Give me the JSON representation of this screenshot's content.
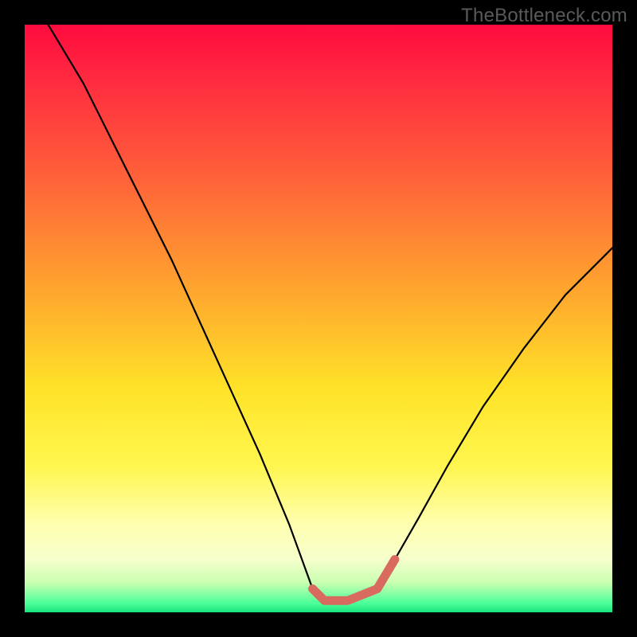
{
  "watermark": "TheBottleneck.com",
  "chart_data": {
    "type": "line",
    "title": "",
    "xlabel": "",
    "ylabel": "",
    "xlim": [
      0,
      100
    ],
    "ylim": [
      0,
      100
    ],
    "grid": false,
    "series": [
      {
        "name": "bottleneck-curve",
        "x": [
          4,
          10,
          15,
          20,
          25,
          30,
          35,
          40,
          45,
          49,
          51,
          55,
          60,
          63,
          67,
          72,
          78,
          85,
          92,
          100
        ],
        "values": [
          100,
          90,
          80,
          70,
          60,
          49,
          38,
          27,
          15,
          4,
          2,
          2,
          4,
          9,
          16,
          25,
          35,
          45,
          54,
          62
        ]
      }
    ],
    "highlight_segment": {
      "x": [
        49,
        51,
        55,
        60,
        63
      ],
      "values": [
        4,
        2,
        2,
        4,
        9
      ]
    },
    "gradient_stops": [
      {
        "pos": 0.0,
        "color": "#ff0b3e"
      },
      {
        "pos": 0.08,
        "color": "#ff2640"
      },
      {
        "pos": 0.25,
        "color": "#ff5e3a"
      },
      {
        "pos": 0.45,
        "color": "#ffa52e"
      },
      {
        "pos": 0.62,
        "color": "#ffe328"
      },
      {
        "pos": 0.75,
        "color": "#fff64e"
      },
      {
        "pos": 0.85,
        "color": "#ffffb0"
      },
      {
        "pos": 0.91,
        "color": "#f6ffcc"
      },
      {
        "pos": 0.95,
        "color": "#c8ffb0"
      },
      {
        "pos": 0.985,
        "color": "#4bff9a"
      },
      {
        "pos": 1.0,
        "color": "#19e27d"
      }
    ]
  }
}
